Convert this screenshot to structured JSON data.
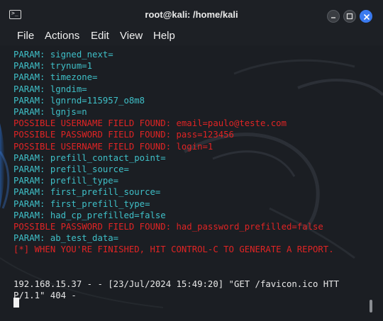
{
  "window": {
    "title": "root@kali: /home/kali",
    "icon": "terminal-icon",
    "prompt_glyph": ">_",
    "controls": [
      "minimize-icon",
      "maximize-icon",
      "close-icon"
    ]
  },
  "menu": {
    "items": [
      "File",
      "Actions",
      "Edit",
      "View",
      "Help"
    ]
  },
  "terminal": {
    "colors": {
      "param": "#3fc0c8",
      "warning": "#e02424",
      "text": "#e8e8e8",
      "background": "#1b1e23"
    },
    "lines": [
      {
        "text": "PARAM: signed_next=",
        "kind": "param"
      },
      {
        "text": "PARAM: trynum=1",
        "kind": "param"
      },
      {
        "text": "PARAM: timezone=",
        "kind": "param"
      },
      {
        "text": "PARAM: lgndim=",
        "kind": "param"
      },
      {
        "text": "PARAM: lgnrnd=115957_o8m8",
        "kind": "param"
      },
      {
        "text": "PARAM: lgnjs=n",
        "kind": "param"
      },
      {
        "text": "POSSIBLE USERNAME FIELD FOUND: email=paulo@teste.com",
        "kind": "warning"
      },
      {
        "text": "POSSIBLE PASSWORD FIELD FOUND: pass=123456",
        "kind": "warning"
      },
      {
        "text": "POSSIBLE USERNAME FIELD FOUND: login=1",
        "kind": "warning"
      },
      {
        "text": "PARAM: prefill_contact_point=",
        "kind": "param"
      },
      {
        "text": "PARAM: prefill_source=",
        "kind": "param"
      },
      {
        "text": "PARAM: prefill_type=",
        "kind": "param"
      },
      {
        "text": "PARAM: first_prefill_source=",
        "kind": "param"
      },
      {
        "text": "PARAM: first_prefill_type=",
        "kind": "param"
      },
      {
        "text": "PARAM: had_cp_prefilled=false",
        "kind": "param"
      },
      {
        "text": "POSSIBLE PASSWORD FIELD FOUND: had_password_prefilled=false",
        "kind": "warning"
      },
      {
        "text": "PARAM: ab_test_data=",
        "kind": "param"
      },
      {
        "text": "[*] WHEN YOU'RE FINISHED, HIT CONTROL-C TO GENERATE A REPORT.",
        "kind": "warning"
      },
      {
        "text": "",
        "kind": "text"
      },
      {
        "text": "",
        "kind": "text"
      },
      {
        "text": "192.168.15.37 - - [23/Jul/2024 15:49:20] \"GET /favicon.ico HTT",
        "kind": "text"
      },
      {
        "text": "P/1.1\" 404 -",
        "kind": "text"
      }
    ]
  }
}
